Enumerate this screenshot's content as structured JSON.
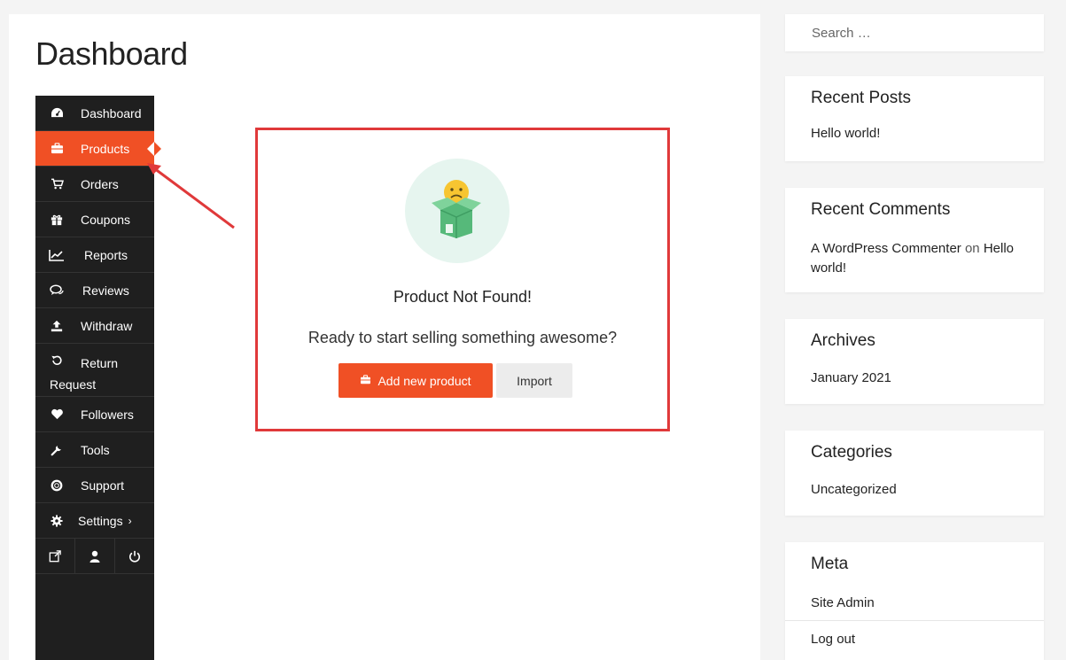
{
  "page": {
    "title": "Dashboard"
  },
  "nav": {
    "items": [
      {
        "label": "Dashboard",
        "icon": "dashboard-icon"
      },
      {
        "label": "Products",
        "icon": "briefcase-icon",
        "active": true
      },
      {
        "label": "Orders",
        "icon": "cart-icon"
      },
      {
        "label": "Coupons",
        "icon": "gift-icon"
      },
      {
        "label": "Reports",
        "icon": "chart-icon"
      },
      {
        "label": "Reviews",
        "icon": "comments-icon"
      },
      {
        "label": "Withdraw",
        "icon": "upload-icon"
      },
      {
        "label_line1": "Return",
        "label_line2": "Request",
        "icon": "undo-icon"
      },
      {
        "label": "Followers",
        "icon": "heart-icon"
      },
      {
        "label": "Tools",
        "icon": "wrench-icon"
      },
      {
        "label": "Support",
        "icon": "lifebuoy-icon"
      },
      {
        "label": "Settings",
        "caret": "›",
        "icon": "gear-icon"
      }
    ],
    "bottom": [
      "external-link-icon",
      "user-icon",
      "power-icon"
    ]
  },
  "empty_state": {
    "title": "Product Not Found!",
    "subtitle": "Ready to start selling something awesome?",
    "add_label": "Add new product",
    "import_label": "Import"
  },
  "sidebar": {
    "search_placeholder": "Search …",
    "recent_posts": {
      "title": "Recent Posts",
      "items": [
        "Hello world!"
      ]
    },
    "recent_comments": {
      "title": "Recent Comments",
      "author": "A WordPress Commenter",
      "on": "on",
      "post": "Hello world!"
    },
    "archives": {
      "title": "Archives",
      "items": [
        "January 2021"
      ]
    },
    "categories": {
      "title": "Categories",
      "items": [
        "Uncategorized"
      ]
    },
    "meta": {
      "title": "Meta",
      "items": [
        "Site Admin",
        "Log out"
      ]
    }
  },
  "colors": {
    "accent": "#f05025",
    "annotation": "#e0393a",
    "nav_bg": "#1f1f1f"
  }
}
